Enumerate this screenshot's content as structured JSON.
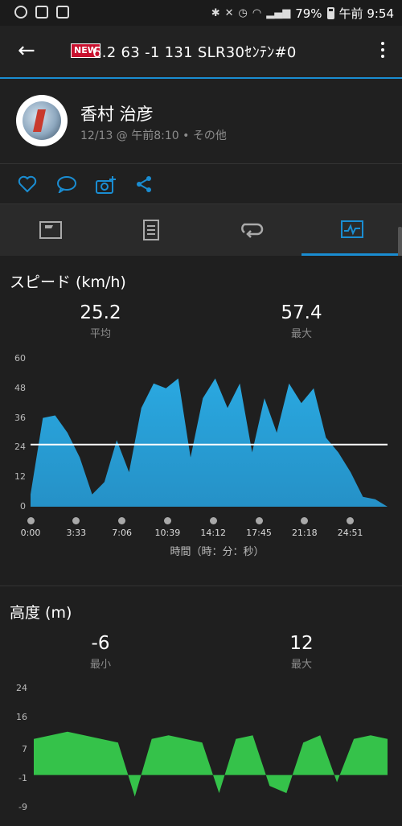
{
  "status_bar": {
    "battery": "79%",
    "time": "午前 9:54"
  },
  "app_bar": {
    "title": "6.2  63  -1  131  SLR30ｾﾝﾃﾝ#0"
  },
  "activity": {
    "user_name": "香村 治彦",
    "date": "12/13 @ 午前8:10 • その他"
  },
  "speed": {
    "title": "スピード (km/h)",
    "avg_value": "25.2",
    "avg_label": "平均",
    "max_value": "57.4",
    "max_label": "最大",
    "y_ticks": [
      "60",
      "48",
      "36",
      "24",
      "12",
      "0"
    ],
    "x_ticks": [
      "0:00",
      "3:33",
      "7:06",
      "10:39",
      "14:12",
      "17:45",
      "21:18",
      "24:51"
    ],
    "x_title": "時間（時：分：秒）",
    "fill_color": "#2591c7",
    "avg_line_color": "#ffffff"
  },
  "elevation": {
    "title": "高度 (m)",
    "min_value": "-6",
    "min_label": "最小",
    "max_value": "12",
    "max_label": "最大",
    "y_ticks": [
      "24",
      "16",
      "7",
      "-1",
      "-9"
    ],
    "fill_color": "#35c24a"
  },
  "chart_data": [
    {
      "type": "area",
      "title": "スピード (km/h)",
      "xlabel": "時間（時：分：秒）",
      "ylabel": "km/h",
      "ylim": [
        0,
        60
      ],
      "x": [
        "0:00",
        "1:00",
        "1:30",
        "2:00",
        "3:00",
        "4:00",
        "5:00",
        "6:00",
        "7:00",
        "8:00",
        "9:00",
        "10:00",
        "11:00",
        "12:00",
        "13:00",
        "14:00",
        "15:00",
        "16:00",
        "17:00",
        "18:00",
        "19:00",
        "20:00",
        "21:00",
        "22:00",
        "23:00",
        "24:00",
        "25:00",
        "26:00",
        "27:00",
        "28:00"
      ],
      "values": [
        5,
        36,
        37,
        30,
        20,
        5,
        10,
        27,
        14,
        40,
        50,
        48,
        52,
        20,
        44,
        52,
        40,
        50,
        22,
        44,
        30,
        50,
        42,
        48,
        28,
        22,
        14,
        4,
        3,
        0
      ],
      "average": 25.2,
      "max": 57.4
    },
    {
      "type": "area",
      "title": "高度 (m)",
      "ylabel": "m",
      "ylim": [
        -9,
        24
      ],
      "x": [
        "0:00",
        "3:33",
        "7:06",
        "10:39",
        "14:12",
        "17:45",
        "21:18",
        "24:51"
      ],
      "values": [
        10,
        11,
        12,
        11,
        10,
        9,
        -6,
        10,
        11,
        10,
        9,
        -5,
        10,
        11,
        -3,
        -5,
        9,
        11,
        -2,
        10,
        11,
        10
      ],
      "min": -6,
      "max": 12
    }
  ]
}
